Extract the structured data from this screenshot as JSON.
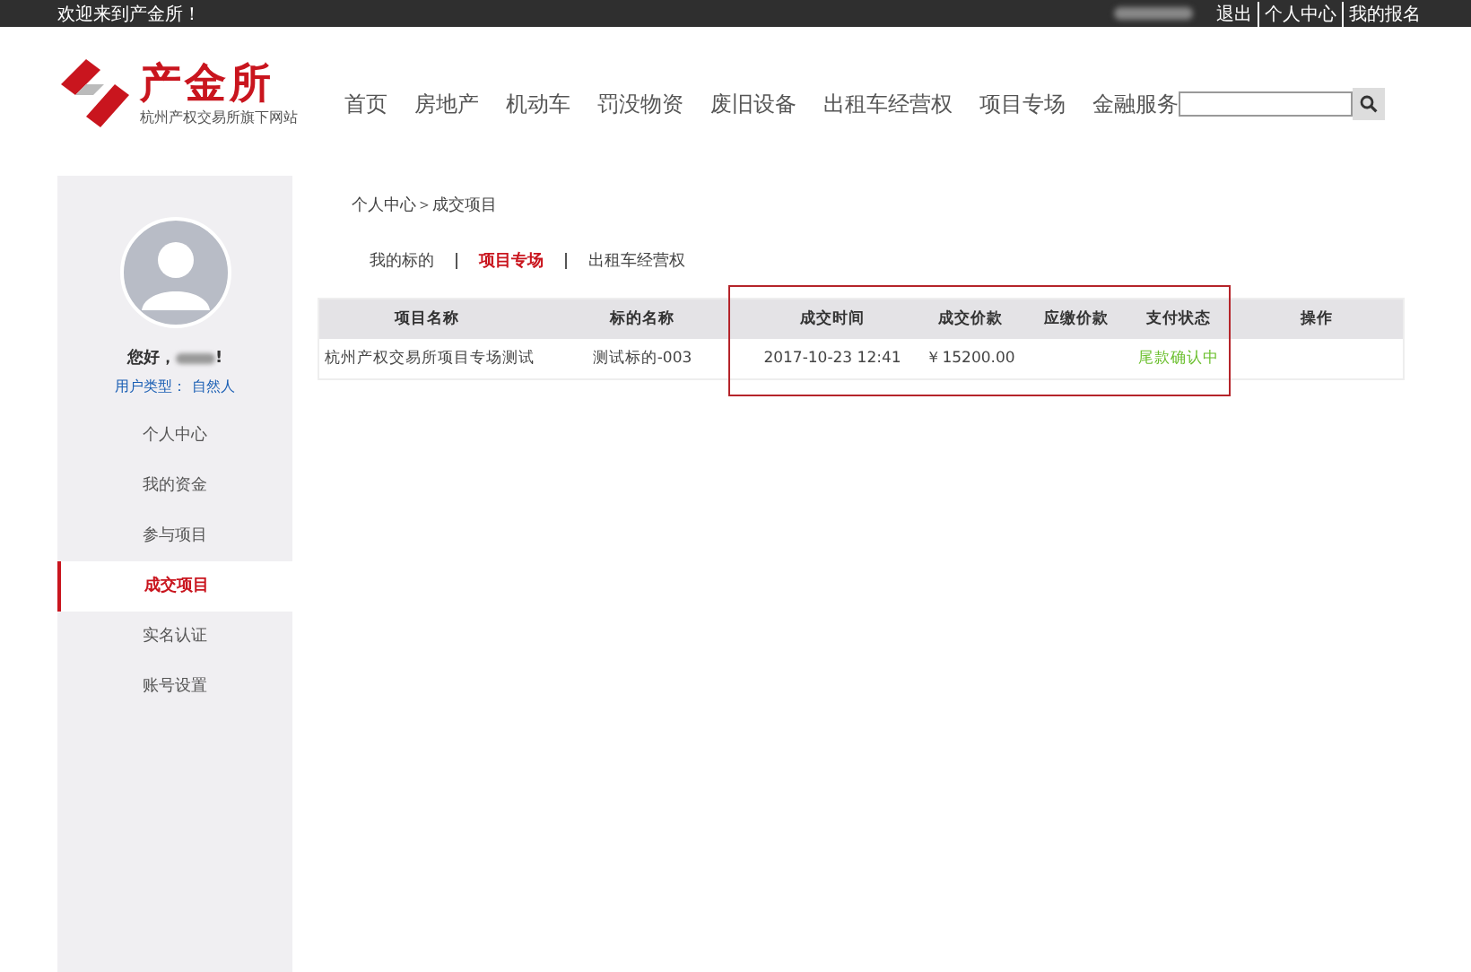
{
  "top_bar": {
    "welcome": "欢迎来到产金所！",
    "links": [
      "退出",
      "个人中心",
      "我的报名"
    ]
  },
  "logo": {
    "name": "产金所",
    "subtitle": "杭州产权交易所旗下网站"
  },
  "nav": [
    "首页",
    "房地产",
    "机动车",
    "罚没物资",
    "废旧设备",
    "出租车经营权",
    "项目专场",
    "金融服务"
  ],
  "sidebar": {
    "greeting": "您好，",
    "greeting_end": "!",
    "user_type": "用户类型： 自然人",
    "items": [
      {
        "label": "个人中心",
        "selected": false
      },
      {
        "label": "我的资金",
        "selected": false
      },
      {
        "label": "参与项目",
        "selected": false
      },
      {
        "label": "成交项目",
        "selected": true
      },
      {
        "label": "实名认证",
        "selected": false
      },
      {
        "label": "账号设置",
        "selected": false
      }
    ]
  },
  "breadcrumb": "个人中心＞成交项目",
  "tabs": [
    {
      "label": "我的标的",
      "selected": false
    },
    {
      "label": "项目专场",
      "selected": true
    },
    {
      "label": "出租车经营权",
      "selected": false
    }
  ],
  "table": {
    "columns": [
      "项目名称",
      "标的名称",
      "成交时间",
      "成交价款",
      "应缴价款",
      "支付状态",
      "操作"
    ],
    "rows": [
      {
        "cells": [
          "杭州产权交易所项目专场测试",
          "测试标的-003",
          "2017-10-23 12:41",
          "￥15200.00",
          "",
          "尾款确认中",
          ""
        ]
      }
    ]
  }
}
